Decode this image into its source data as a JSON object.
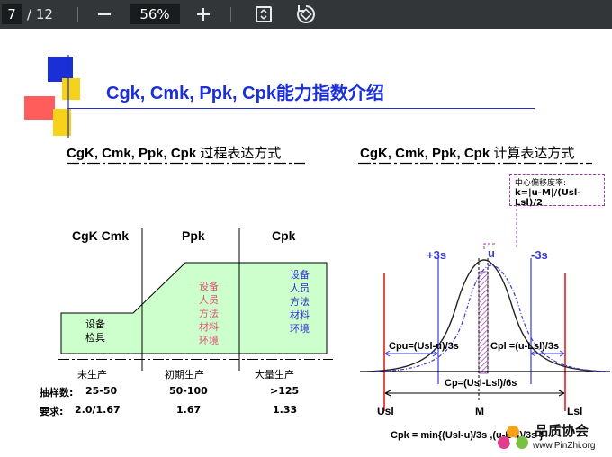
{
  "toolbar": {
    "current_page": "7",
    "total_pages": "/ 12",
    "zoom": "56%"
  },
  "slide": {
    "title": "Cgk, Cmk, Ppk, Cpk能力指数介绍",
    "left": {
      "subtitle_en": "CgK, Cmk, Ppk, Cpk",
      "subtitle_cn": "过程表达方式",
      "stages": [
        "CgK Cmk",
        "Ppk",
        "Cpk"
      ],
      "stage1_items": [
        "设备",
        "检具"
      ],
      "stage2_items": [
        "设备",
        "人员",
        "方法",
        "材料",
        "环境"
      ],
      "stage3_items": [
        "设备",
        "人员",
        "方法",
        "材料",
        "环境"
      ],
      "phases": [
        "未生产",
        "初期生产",
        "大量生产"
      ],
      "sample_label": "抽样数:",
      "sample_values": [
        "25-50",
        "50-100",
        ">125"
      ],
      "req_label": "要求:",
      "req_values": [
        "2.0/1.67",
        "1.67",
        "1.33"
      ]
    },
    "right": {
      "subtitle_en": "CgK, Cmk, Ppk, Cpk",
      "subtitle_cn": "计算表达方式",
      "callout_line1": "中心偏移度率:",
      "callout_line2": "k=|u-M|/(Usl-Lsl)/2",
      "plus3s": "+3s",
      "u": "u",
      "minus3s": "-3s",
      "cpu": "Cpu=(Usl-u)/3s",
      "cpl": "Cpl =(u-Lsl)/3s",
      "cp": "Cp=(Usl-Lsl)/6s",
      "usl": "Usl",
      "m": "M",
      "lsl": "Lsl",
      "cpk": "Cpk = min{(Usl-u)/3s ,(u-Lsl)/3s }"
    },
    "watermark": {
      "name": "品质协会",
      "url": "www.PinZhi.org"
    }
  },
  "colors": {
    "title": "#1a2fd6",
    "fill_green": "#ccffcc",
    "pink_text": "#e0507a",
    "blue_text": "#3030d0",
    "spec_red": "#e00000",
    "sigma_blue": "#3a3ad8",
    "hatch_purple": "#9a3aa8"
  }
}
